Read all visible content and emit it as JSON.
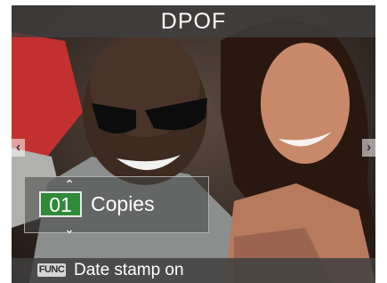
{
  "header": {
    "title": "DPOF"
  },
  "navigation": {
    "prev_glyph": "‹",
    "next_glyph": "›"
  },
  "copies": {
    "value": "01",
    "label": "Copies",
    "up_glyph": "⌃",
    "down_glyph": "⌄"
  },
  "footer": {
    "func_badge": "FUNC",
    "text": "Date stamp on"
  },
  "colors": {
    "count_box": "#2f8a3a",
    "title_bar": "#404040"
  },
  "icons": [
    "photo-preview",
    "nav-left-icon",
    "nav-right-icon",
    "increment-icon",
    "decrement-icon",
    "func-icon"
  ]
}
